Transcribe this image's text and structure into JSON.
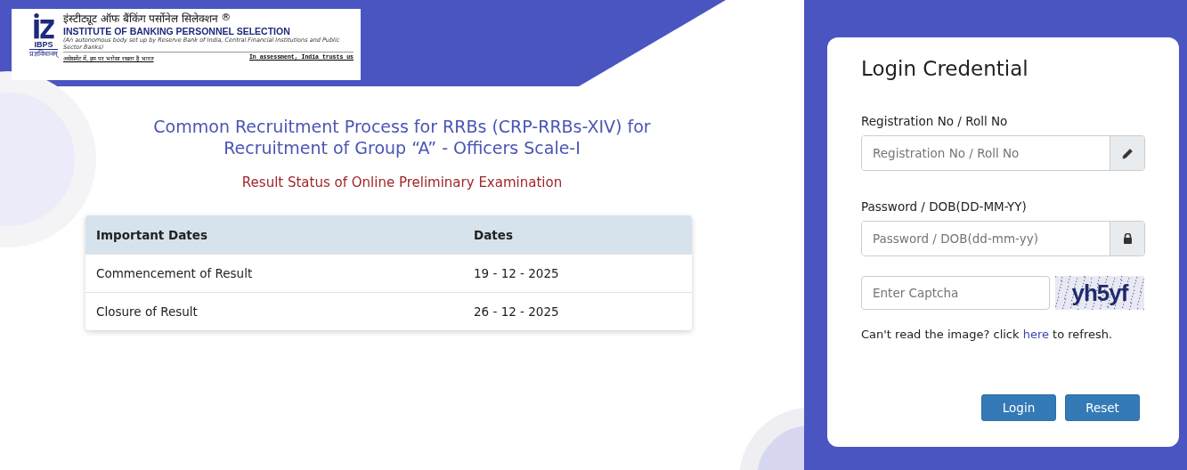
{
  "logo": {
    "hindi_name": "इंस्टीट्यूट ऑफ बैंकिंग पर्सोनेल सिलेक्शन",
    "registered": "®",
    "english_name": "INSTITUTE OF BANKING PERSONNEL SELECTION",
    "english_note": "(An autonomous body set up by Reserve Bank of India, Central Financial Institutions and Public Sector Banks)",
    "hindi_slogan": "असेसमेंट में, हम पर भरोसा रखता है भारत",
    "english_slogan": "In assessment, India trusts us",
    "emblem_label": "IBPS",
    "emblem_motto": "प्रज्ञविधानम्"
  },
  "main": {
    "title": "Common Recruitment Process for RRBs (CRP-RRBs-XIV) for Recruitment of Group “A” - Officers Scale-I",
    "subtitle": "Result Status of Online Preliminary Examination",
    "table": {
      "columns": [
        "Important Dates",
        "Dates"
      ],
      "rows": [
        [
          "Commencement of Result",
          "19 - 12 - 2025"
        ],
        [
          "Closure of Result",
          "26 - 12 - 2025"
        ]
      ]
    }
  },
  "login": {
    "heading": "Login Credential",
    "fields": [
      {
        "kind": "text",
        "label": "Registration No / Roll No",
        "placeholder": "Registration No / Roll No"
      },
      {
        "kind": "password",
        "label": "Password / DOB(DD-MM-YY)",
        "placeholder": "Password / DOB(dd-mm-yy)"
      }
    ],
    "captcha": {
      "placeholder": "Enter Captcha",
      "code": "yh5yf"
    },
    "refresh_note": {
      "before": "Can't read the image? click",
      "link": "here",
      "after": "to refresh."
    },
    "buttons": [
      "Login",
      "Reset"
    ]
  }
}
